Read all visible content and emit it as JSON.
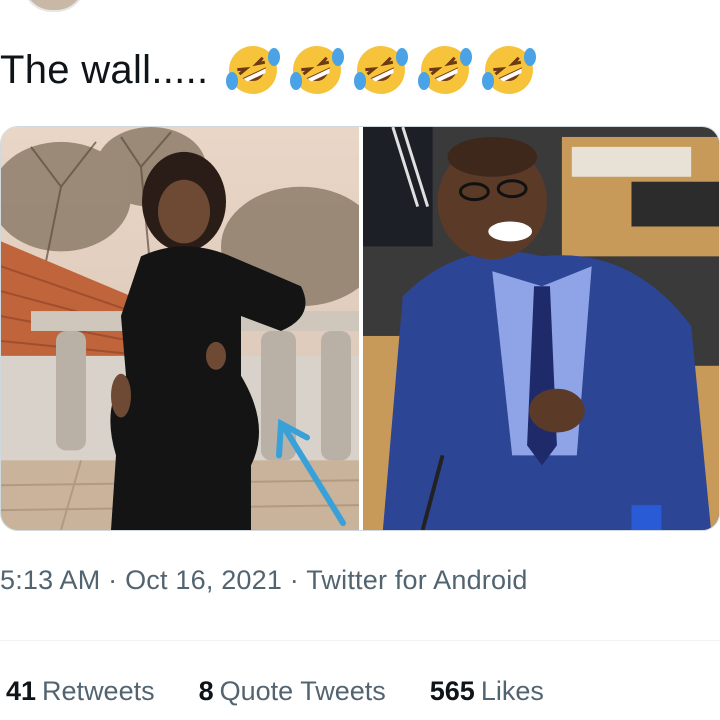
{
  "tweet": {
    "text": "The wall.....",
    "emojis": [
      "rolling-on-floor-laughing-icon",
      "rolling-on-floor-laughing-icon",
      "rolling-on-floor-laughing-icon",
      "rolling-on-floor-laughing-icon",
      "rolling-on-floor-laughing-icon"
    ],
    "media": {
      "left_image": "woman-on-balcony-photo",
      "right_image": "man-laughing-in-parliament-photo"
    },
    "time": "5:13 AM",
    "date": "Oct 16, 2021",
    "client": "Twitter for Android",
    "separator": "·"
  },
  "stats": {
    "retweets": {
      "count": "41",
      "label": "Retweets"
    },
    "quotes": {
      "count": "8",
      "label": "Quote Tweets"
    },
    "likes": {
      "count": "565",
      "label": "Likes"
    }
  },
  "colors": {
    "text": "#0f1419",
    "muted": "#536471",
    "arrow": "#3aa0d8",
    "emoji_face": "#f6c33b",
    "emoji_tear": "#4aa3e6"
  }
}
